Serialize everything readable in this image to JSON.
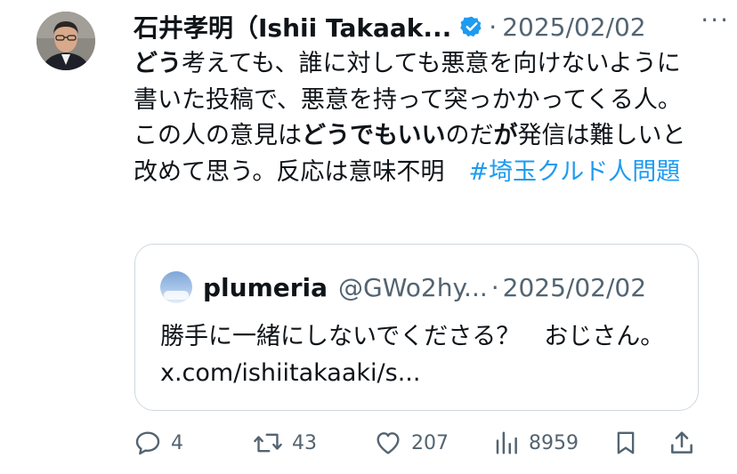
{
  "post": {
    "author": "石井孝明（Ishii Takaak...",
    "date": "2025/02/02",
    "more_label": "···",
    "text_segments": [
      {
        "text": "どう",
        "bold": true
      },
      {
        "text": "考えても、誰に対しても悪意を向けないように書いた投稿で、悪意を持って突っかかってくる人。この人の意見は",
        "bold": false
      },
      {
        "text": "どうでもいい",
        "bold": true
      },
      {
        "text": "のだ",
        "bold": false
      },
      {
        "text": "が",
        "bold": true
      },
      {
        "text": "発信は難しいと改めて思う。反応は意味不明　",
        "bold": false
      }
    ],
    "hashtag": "#埼玉クルド人問題"
  },
  "quote": {
    "name": "plumeria",
    "handle": "@GWo2hy...",
    "date": "2025/02/02",
    "text": "勝手に一緒にしないでくださる？　おじさん。 x.com/ishiitakaaki/s..."
  },
  "actions": {
    "replies": "4",
    "reposts": "43",
    "likes": "207",
    "views": "8959"
  },
  "colors": {
    "accent": "#1d9bf0",
    "muted": "#536471",
    "text": "#0f1419",
    "border": "#cfd9de"
  },
  "icons": [
    "verified-badge-icon",
    "more-icon",
    "reply-icon",
    "repost-icon",
    "like-icon",
    "views-icon",
    "bookmark-icon",
    "share-icon"
  ]
}
